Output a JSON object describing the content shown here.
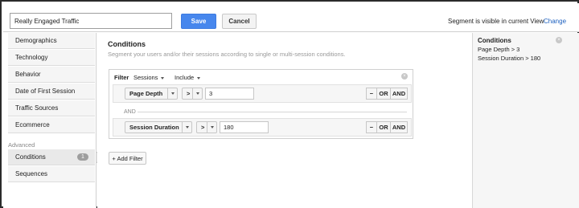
{
  "header": {
    "segment_name": "Really Engaged Traffic",
    "save_label": "Save",
    "cancel_label": "Cancel",
    "visibility_text": "Segment is visible in current View",
    "change_label": "Change"
  },
  "sidebar": {
    "items": [
      {
        "label": "Demographics"
      },
      {
        "label": "Technology"
      },
      {
        "label": "Behavior"
      },
      {
        "label": "Date of First Session"
      },
      {
        "label": "Traffic Sources"
      },
      {
        "label": "Ecommerce"
      }
    ],
    "advanced_label": "Advanced",
    "advanced_items": [
      {
        "label": "Conditions",
        "badge": "1",
        "active": true
      },
      {
        "label": "Sequences"
      }
    ]
  },
  "conditions": {
    "title": "Conditions",
    "subtitle": "Segment your users and/or their sessions according to single or multi-session conditions.",
    "filter": {
      "label": "Filter",
      "scope": "Sessions",
      "mode": "Include",
      "close_icon": "×",
      "rows": [
        {
          "dimension": "Page Depth",
          "operator": ">",
          "value": "3"
        },
        {
          "dimension": "Session Duration",
          "operator": ">",
          "value": "180"
        }
      ],
      "joiner": "AND",
      "buttons": {
        "remove": "−",
        "or": "OR",
        "and": "AND"
      }
    },
    "add_filter_label": "+ Add Filter"
  },
  "summary": {
    "title": "Conditions",
    "close_icon": "×",
    "lines": [
      "Page Depth > 3",
      "Session Duration > 180"
    ]
  },
  "colors": {
    "accent": "#4787ed",
    "link": "#1a5fbf"
  }
}
